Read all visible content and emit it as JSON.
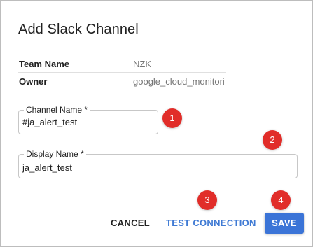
{
  "dialog": {
    "title": "Add Slack Channel",
    "info": [
      {
        "label": "Team Name",
        "value": "NZK"
      },
      {
        "label": "Owner",
        "value": "google_cloud_monitori"
      }
    ],
    "channel_name": {
      "label": "Channel Name *",
      "value": "#ja_alert_test"
    },
    "display_name": {
      "label": "Display Name *",
      "value": "ja_alert_test"
    },
    "buttons": {
      "cancel": "CANCEL",
      "test_connection": "TEST CONNECTION",
      "save": "SAVE"
    }
  },
  "annotations": [
    "1",
    "2",
    "3",
    "4"
  ],
  "colors": {
    "badge": "#e12d29",
    "primary": "#3b74d7",
    "link": "#3f7ad4"
  }
}
